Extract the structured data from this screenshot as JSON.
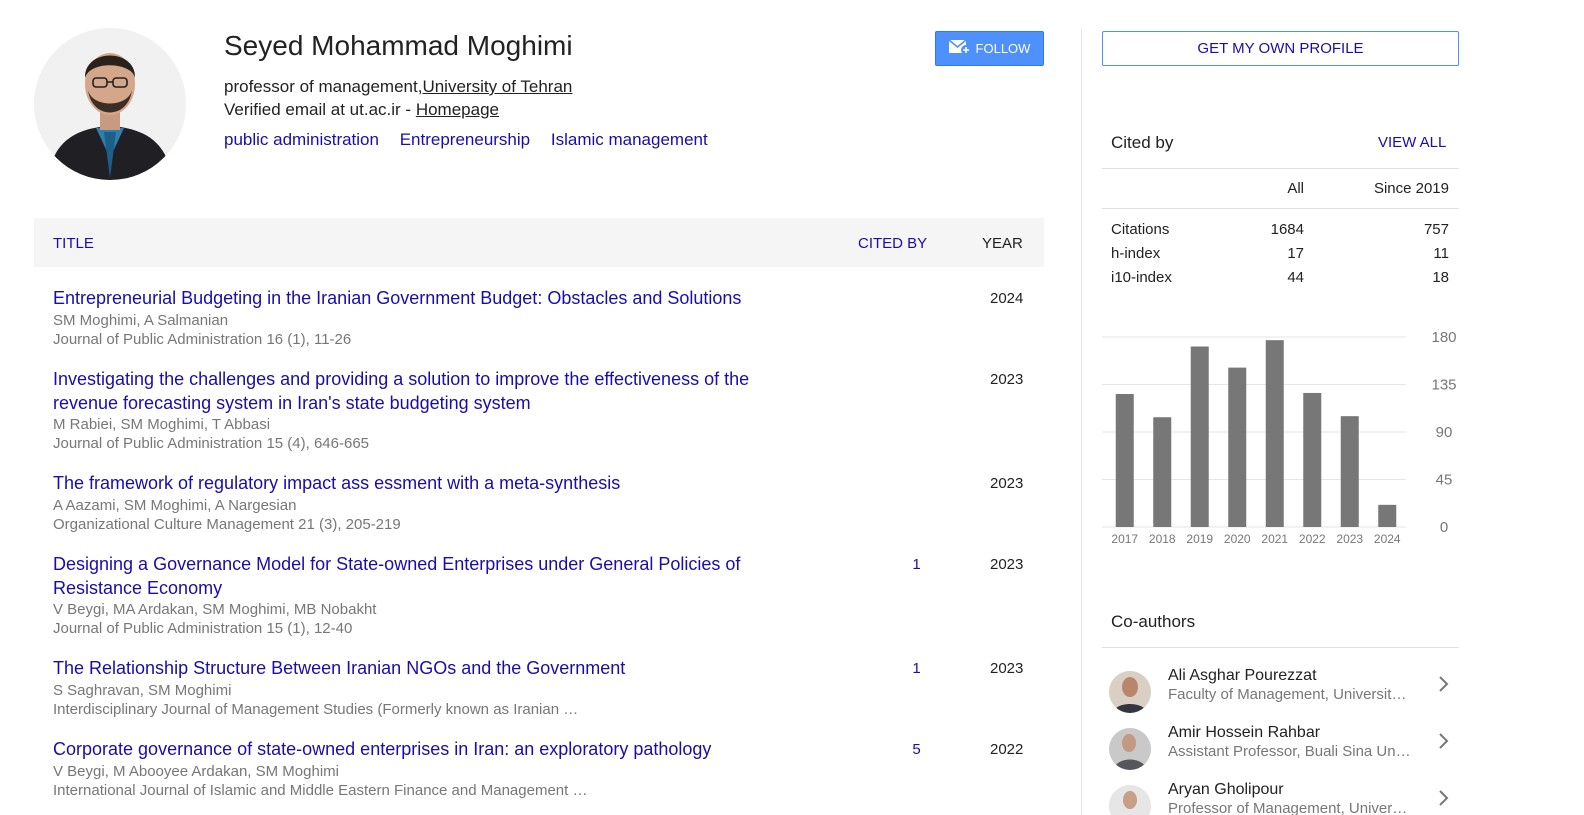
{
  "profile": {
    "name": "Seyed Mohammad Moghimi",
    "affiliation_prefix": "professor of management,",
    "affiliation_link": "University of Tehran",
    "email_text": "Verified email at ut.ac.ir - ",
    "homepage_label": "Homepage",
    "interests": [
      "public administration",
      "Entrepreneurship",
      "Islamic management"
    ],
    "follow_label": "FOLLOW"
  },
  "table": {
    "headers": {
      "title": "TITLE",
      "cited_by": "CITED BY",
      "year": "YEAR"
    },
    "rows": [
      {
        "title": "Entrepreneurial Budgeting in the Iranian Government Budget: Obstacles and Solutions",
        "authors": "SM Moghimi, A Salmanian",
        "venue": "Journal of Public Administration 16 (1), 11-26",
        "cited_by": "",
        "year": "2024"
      },
      {
        "title": "Investigating the challenges and providing a solution to improve the effectiveness of the revenue forecasting system in Iran's state budgeting system",
        "authors": "M Rabiei, SM Moghimi, T Abbasi",
        "venue": "Journal of Public Administration 15 (4), 646-665",
        "cited_by": "",
        "year": "2023"
      },
      {
        "title": "The framework of regulatory impact ass essment with a meta-synthesis",
        "authors": "A Aazami, SM Moghimi, A Nargesian",
        "venue": "Organizational Culture Management 21 (3), 205-219",
        "cited_by": "",
        "year": "2023"
      },
      {
        "title": "Designing a Governance Model for State-owned Enterprises under General Policies of Resistance Economy",
        "authors": "V Beygi, MA Ardakan, SM Moghimi, MB Nobakht",
        "venue": "Journal of Public Administration 15 (1), 12-40",
        "cited_by": "1",
        "year": "2023"
      },
      {
        "title": "The Relationship Structure Between Iranian NGOs and the Government",
        "authors": "S Saghravan, SM Moghimi",
        "venue": "Interdisciplinary Journal of Management Studies (Formerly known as Iranian …",
        "cited_by": "1",
        "year": "2023"
      },
      {
        "title": "Corporate governance of state-owned enterprises in Iran: an exploratory pathology",
        "authors": "V Beygi, M Abooyee Ardakan, SM Moghimi",
        "venue": "International Journal of Islamic and Middle Eastern Finance and Management …",
        "cited_by": "5",
        "year": "2022"
      }
    ]
  },
  "sidebar": {
    "own_profile_label": "GET MY OWN PROFILE",
    "cited_by_heading": "Cited by",
    "view_all_label": "VIEW ALL",
    "col_all": "All",
    "col_since": "Since 2019",
    "metrics": [
      {
        "label": "Citations",
        "all": "1684",
        "since": "757"
      },
      {
        "label": "h-index",
        "all": "17",
        "since": "11"
      },
      {
        "label": "i10-index",
        "all": "44",
        "since": "18"
      }
    ],
    "coauthors_heading": "Co-authors",
    "coauthors": [
      {
        "name": "Ali Asghar Pourezzat",
        "affiliation": "Faculty of Management, University of Tehran"
      },
      {
        "name": "Amir Hossein Rahbar",
        "affiliation": "Assistant Professor, Buali Sina University"
      },
      {
        "name": "Aryan Gholipour",
        "affiliation": "Professor of Management, University of Tehran"
      }
    ]
  },
  "chart_data": {
    "type": "bar",
    "categories": [
      "2017",
      "2018",
      "2019",
      "2020",
      "2021",
      "2022",
      "2023",
      "2024"
    ],
    "values": [
      126,
      104,
      171,
      151,
      177,
      127,
      105,
      21
    ],
    "yticks": [
      180,
      135,
      90,
      45,
      0
    ],
    "ylim": [
      0,
      180
    ],
    "bar_color": "#777777",
    "grid": true
  },
  "colors": {
    "link": "#1a0dab",
    "follow_bg": "#4d90fe",
    "muted": "#777777",
    "header_bg": "#f5f5f5"
  },
  "icons": {
    "follow": "mail-plus-icon",
    "chevron": "chevron-right-icon"
  }
}
